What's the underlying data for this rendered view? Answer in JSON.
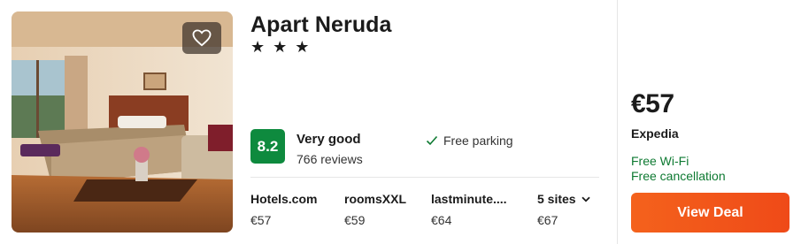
{
  "hotel": {
    "name": "Apart Neruda",
    "stars_text": "★ ★ ★",
    "star_count": 3
  },
  "rating": {
    "score": "8.2",
    "label": "Very good",
    "reviews": "766 reviews"
  },
  "amenity": {
    "label": "Free parking"
  },
  "sites": [
    {
      "name": "Hotels.com",
      "price": "€57"
    },
    {
      "name": "roomsXXL",
      "price": "€59"
    },
    {
      "name": "lastminute....",
      "price": "€64"
    },
    {
      "name": "5 sites",
      "price": "€67"
    }
  ],
  "deal": {
    "price": "€57",
    "provider": "Expedia",
    "perks": [
      "Free Wi-Fi",
      "Free cancellation"
    ],
    "button_label": "View Deal"
  },
  "icons": {
    "favorite": "heart-outline-icon",
    "amenity": "checkmark-icon",
    "more_sites": "chevron-down-icon"
  },
  "colors": {
    "rating_badge": "#0e8a3e",
    "perk_text": "#0e7a32",
    "cta_button": "#f05a1a"
  }
}
